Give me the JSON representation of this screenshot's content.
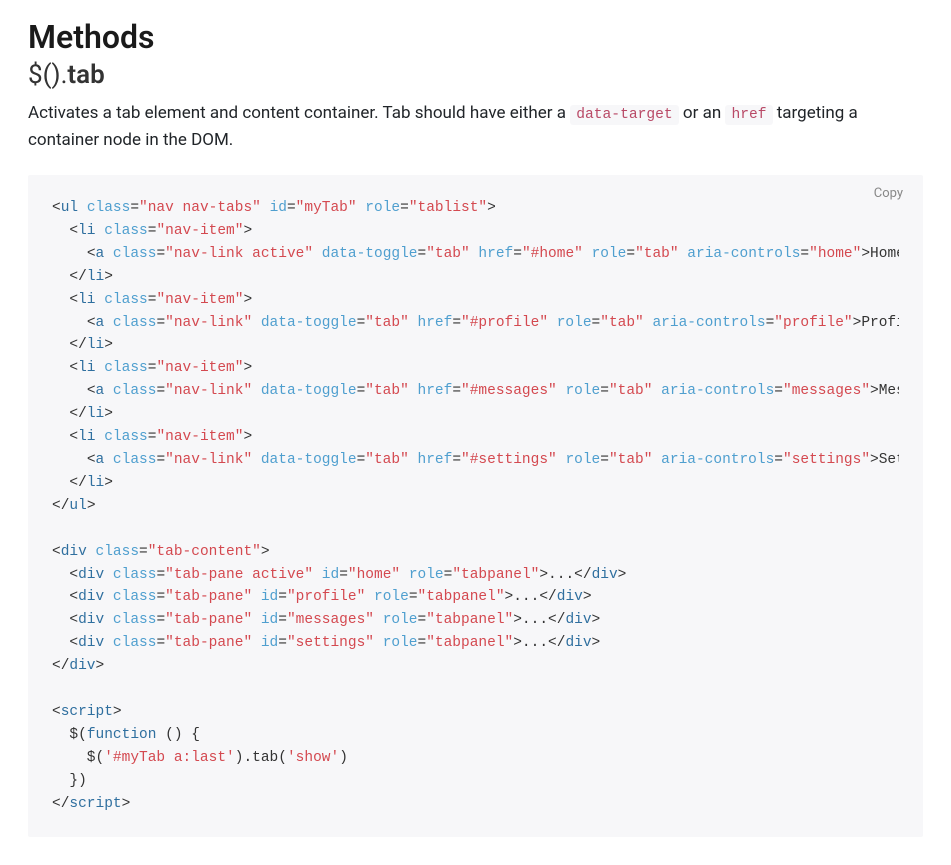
{
  "headings": {
    "methods": "Methods",
    "api_prefix": "$().",
    "api_strong": "tab"
  },
  "desc": {
    "part1": "Activates a tab element and content container. Tab should have either a ",
    "code1": "data-target",
    "mid": " or an ",
    "code2": "href",
    "part2": " targeting a container node in the DOM."
  },
  "copy_label": "Copy",
  "code": {
    "ul_open": {
      "tag": "ul",
      "cls": "nav nav-tabs",
      "id": "myTab",
      "role": "tablist"
    },
    "li_cls": "nav-item",
    "links": [
      {
        "cls": "nav-link active",
        "href": "#home",
        "aria": "home",
        "txt": "Home"
      },
      {
        "cls": "nav-link",
        "href": "#profile",
        "aria": "profile",
        "txt": "Profi"
      },
      {
        "cls": "nav-link",
        "href": "#messages",
        "aria": "messages",
        "txt": "Mes"
      },
      {
        "cls": "nav-link",
        "href": "#settings",
        "aria": "settings",
        "txt": "Set"
      }
    ],
    "toggle": "tab",
    "role_tab": "tab",
    "tabcontent_cls": "tab-content",
    "panes": [
      {
        "cls": "tab-pane active",
        "id": "home",
        "role": "tabpanel",
        "body": "..."
      },
      {
        "cls": "tab-pane",
        "id": "profile",
        "role": "tabpanel",
        "body": "..."
      },
      {
        "cls": "tab-pane",
        "id": "messages",
        "role": "tabpanel",
        "body": "..."
      },
      {
        "cls": "tab-pane",
        "id": "settings",
        "role": "tabpanel",
        "body": "..."
      }
    ],
    "script": {
      "open": "script",
      "jq": "$",
      "fn": "function",
      "sel": "'#myTab a:last'",
      "method": "tab",
      "arg": "'show'"
    }
  }
}
